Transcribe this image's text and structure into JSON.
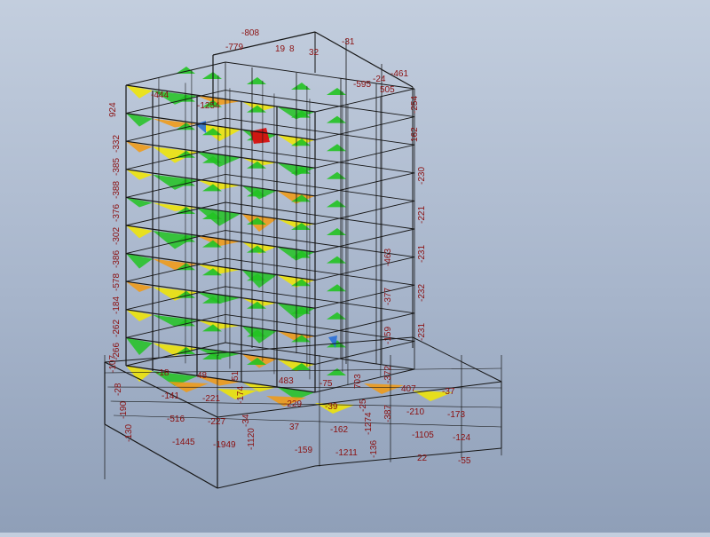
{
  "model": {
    "colors": {
      "background_top": "#c3cede",
      "background_bottom": "#8f9fb8",
      "frame_lines": "#161616",
      "value_labels": "#8b1010",
      "diagram_green": "#22c322",
      "diagram_yellow": "#f2e600",
      "diagram_orange": "#f39a10",
      "diagram_red": "#d81010",
      "diagram_blue": "#2a6fd6"
    },
    "labels": {
      "top": [
        "-808",
        "-779",
        "-31",
        "19",
        "8",
        "32",
        "-461",
        "-24",
        "505",
        "-595",
        "-254",
        "924",
        "-1254",
        "-444",
        "162"
      ],
      "left_columns": [
        "-332",
        "-385",
        "-388",
        "-376",
        "-302",
        "-386",
        "-578",
        "-184",
        "-262",
        "-266"
      ],
      "right_columns": [
        "-230",
        "-221",
        "-231",
        "-232",
        "-231",
        "-463",
        "-377",
        "-159",
        "-372",
        "-387"
      ],
      "podium": [
        "-107",
        "-18",
        "48",
        "51",
        "483",
        "-75",
        "703",
        "407",
        "-37",
        "-28",
        "-141",
        "-221",
        "-174",
        "-229",
        "-39",
        "-25",
        "-210",
        "-173",
        "-190",
        "-516",
        "-227",
        "-34",
        "37",
        "-162",
        "-1274",
        "-1105",
        "-124",
        "-130",
        "-1445",
        "-1949",
        "-1120",
        "-159",
        "-1211",
        "-136",
        "22",
        "-55"
      ]
    }
  }
}
